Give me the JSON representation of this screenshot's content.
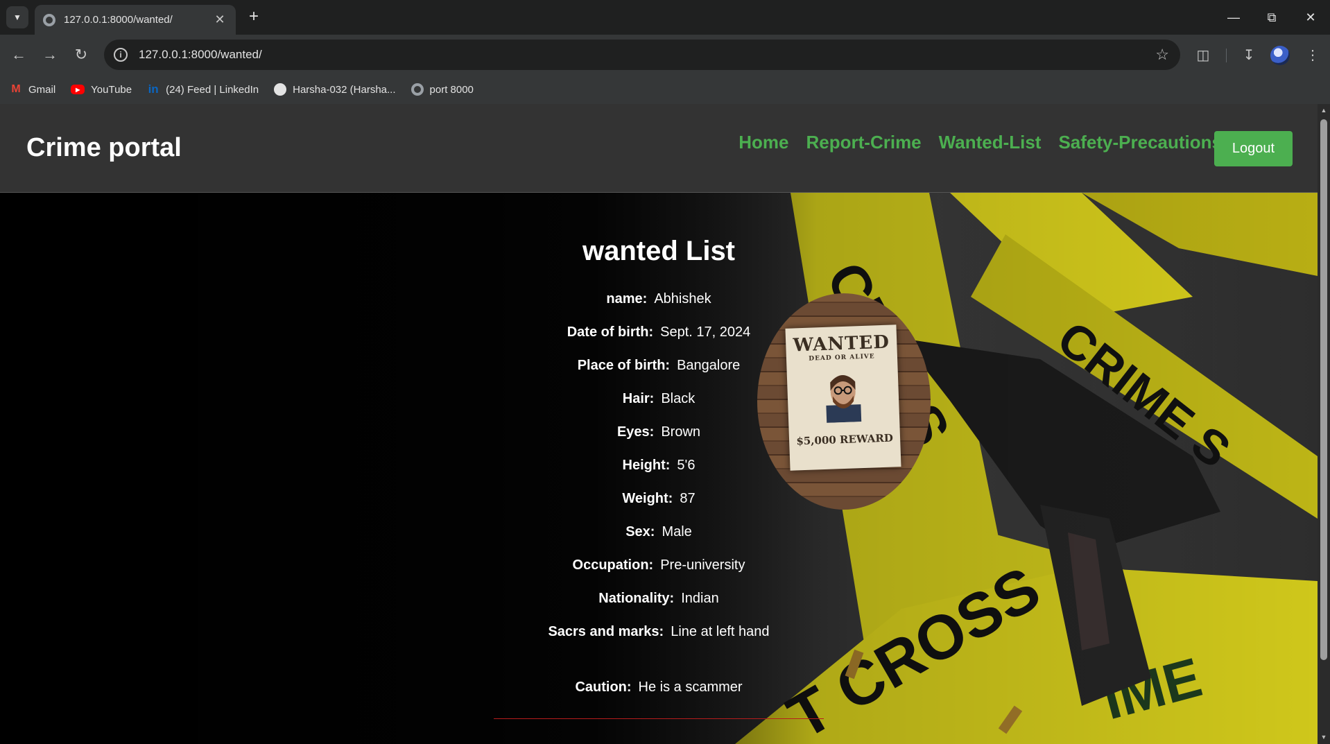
{
  "browser": {
    "tab_title": "127.0.0.1:8000/wanted/",
    "url": "127.0.0.1:8000/wanted/",
    "bookmarks": [
      {
        "label": "Gmail",
        "icon": "gmail-icon"
      },
      {
        "label": "YouTube",
        "icon": "youtube-icon"
      },
      {
        "label": "(24) Feed | LinkedIn",
        "icon": "linkedin-icon"
      },
      {
        "label": "Harsha-032 (Harsha...",
        "icon": "github-icon"
      },
      {
        "label": "port 8000",
        "icon": "globe-icon"
      }
    ]
  },
  "navbar": {
    "brand": "Crime portal",
    "links": [
      "Home",
      "Report-Crime",
      "Wanted-List",
      "Safety-Precautions"
    ],
    "logout": "Logout",
    "accent": "#4caf50"
  },
  "wanted": {
    "title": "wanted List",
    "fields": [
      {
        "label": "name:",
        "value": "Abhishek"
      },
      {
        "label": "Date of birth:",
        "value": "Sept. 17, 2024"
      },
      {
        "label": "Place of birth:",
        "value": "Bangalore"
      },
      {
        "label": "Hair:",
        "value": "Black"
      },
      {
        "label": "Eyes:",
        "value": "Brown"
      },
      {
        "label": "Height:",
        "value": "5'6"
      },
      {
        "label": "Weight:",
        "value": "87"
      },
      {
        "label": "Sex:",
        "value": "Male"
      },
      {
        "label": "Occupation:",
        "value": "Pre-university"
      },
      {
        "label": "Nationality:",
        "value": "Indian"
      },
      {
        "label": "Sacrs and marks:",
        "value": "Line at left hand"
      }
    ],
    "caution": {
      "label": "Caution:",
      "value": "He is a scammer"
    },
    "poster": {
      "heading": "WANTED",
      "subheading": "DEAD OR ALIVE",
      "reward": "$5,000 REWARD"
    }
  }
}
